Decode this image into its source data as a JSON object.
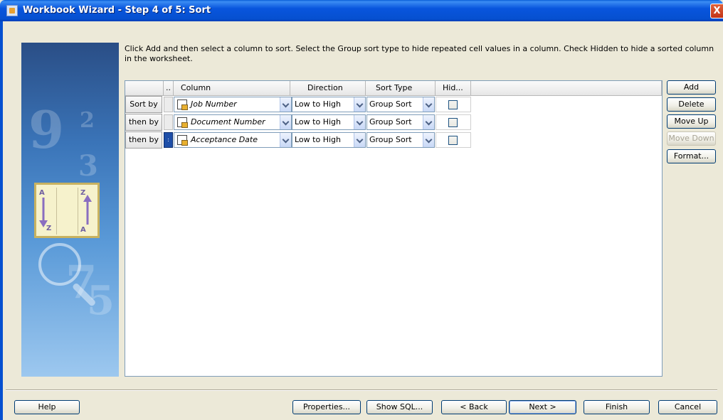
{
  "window": {
    "title": "Workbook Wizard - Step 4 of 5: Sort",
    "close_glyph": "X"
  },
  "instructions": "Click Add and then select a column to sort. Select the Group sort type to hide repeated cell values in a column. Check Hidden to hide a sorted column in the worksheet.",
  "side_art": {
    "numerals": [
      "9",
      "2",
      "3",
      "7",
      "5"
    ],
    "card_letters": [
      "A",
      "Z",
      "Z",
      "A"
    ]
  },
  "grid": {
    "headers": {
      "selector": "..",
      "column": "Column",
      "direction": "Direction",
      "sort_type": "Sort Type",
      "hidden": "Hid..."
    },
    "rows": [
      {
        "label": "Sort by",
        "column": "Job Number",
        "direction": "Low to High",
        "sort_type": "Group Sort",
        "hidden": false,
        "selected": false
      },
      {
        "label": "then by",
        "column": "Document Number",
        "direction": "Low to High",
        "sort_type": "Group Sort",
        "hidden": false,
        "selected": false
      },
      {
        "label": "then by",
        "column": "Acceptance Date",
        "direction": "Low to High",
        "sort_type": "Group Sort",
        "hidden": false,
        "selected": true
      }
    ],
    "selected_row_marker": ":"
  },
  "side_buttons": {
    "add": "Add",
    "delete": "Delete",
    "move_up": "Move Up",
    "move_down": "Move Down",
    "format": "Format..."
  },
  "bottom_buttons": {
    "help": "Help",
    "properties": "Properties...",
    "show_sql": "Show SQL...",
    "back": "< Back",
    "next": "Next >",
    "finish": "Finish",
    "cancel": "Cancel"
  },
  "colors": {
    "title_bar": "#0650d0",
    "dialog_bg": "#ece9d8",
    "selection": "#1f4fa8"
  }
}
